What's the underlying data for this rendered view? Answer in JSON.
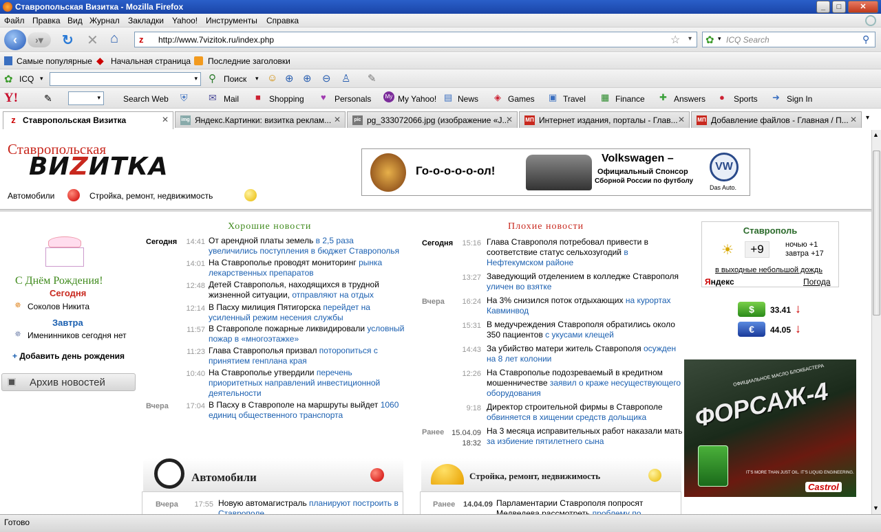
{
  "window": {
    "title": "Ставропольская Визитка - Mozilla Firefox",
    "btn_min": "_",
    "btn_max": "□",
    "btn_close": "✕"
  },
  "menu": [
    "Файл",
    "Правка",
    "Вид",
    "Журнал",
    "Закладки",
    "Yahoo!",
    "Инструменты",
    "Справка"
  ],
  "nav": {
    "url": "http://www.7vizitok.ru/index.php",
    "search_placeholder": "ICQ Search"
  },
  "bookmarks": [
    "Самые популярные",
    "Начальная страница",
    "Последние заголовки"
  ],
  "icqbar": {
    "icq": "ICQ",
    "search": "Поиск"
  },
  "yahoobar": {
    "logo": "Y!",
    "search_web": "Search Web",
    "items": [
      "Mail",
      "Shopping",
      "Personals",
      "My Yahoo!",
      "News",
      "Games",
      "Travel",
      "Finance",
      "Answers",
      "Sports",
      "Sign In"
    ]
  },
  "tabs": [
    {
      "label": "Ставропольская Визитка",
      "icon": "z"
    },
    {
      "label": "Яндекс.Картинки: визитка реклам...",
      "icon": "img"
    },
    {
      "label": "pg_333072066.jpg (изображение «J...",
      "icon": "pic"
    },
    {
      "label": "Интернет издания, порталы - Глав...",
      "icon": "МП"
    },
    {
      "label": "Добавление файлов - Главная / П...",
      "icon": "МП"
    }
  ],
  "site": {
    "logo_top": "Ставропольская",
    "logo_bottom": "ВИЗИТКА",
    "logo_z": "Z",
    "cat1": "Автомобили",
    "cat2": "Стройка, ремонт, недвижимость",
    "banner": {
      "goal": "Го-о-о-о-о-ол!",
      "vw_title": "Volkswagen –",
      "vw_sub1": "Официальный Спонсор",
      "vw_sub2": "Сборной России по футболу",
      "vw_das": "Das Auto."
    }
  },
  "birthday": {
    "title": "С Днём Рождения!",
    "today_label": "Сегодня",
    "today_name": "Соколов Никита",
    "tomorrow_label": "Завтра",
    "tomorrow_text": "Именинников сегодня нет",
    "add": "Добавить день рождения",
    "archive": "Архив новостей"
  },
  "good_news": {
    "title": "Хорошие новости",
    "items": [
      {
        "day": "Сегодня",
        "time": "14:41",
        "text": "От арендной платы земель ",
        "link": "в 2,5 раза увеличились поступления в бюджет Ставрополья"
      },
      {
        "day": "",
        "time": "14:01",
        "text": "На Ставрополье проводят мониторинг ",
        "link": "рынка лекарственных препаратов"
      },
      {
        "day": "",
        "time": "12:48",
        "text": "Детей Ставрополья, находящихся в трудной жизненной ситуации, ",
        "link": "отправляют на отдых"
      },
      {
        "day": "",
        "time": "12:14",
        "text": "В Пасху милиция Пятигорска ",
        "link": "перейдет на усиленный режим несения службы"
      },
      {
        "day": "",
        "time": "11:57",
        "text": "В Ставрополе пожарные ликвидировали ",
        "link": "условный пожар в «многоэтажке»"
      },
      {
        "day": "",
        "time": "11:23",
        "text": "Глава Ставрополья призвал ",
        "link": "поторопиться с принятием генплана края"
      },
      {
        "day": "",
        "time": "10:40",
        "text": "На Ставрополье утвердили ",
        "link": "перечень приоритетных направлений инвестиционной деятельности"
      },
      {
        "day": "Вчера",
        "time": "17:04",
        "text": "В Пасху в Ставрополе на маршруты выйдет ",
        "link": "1060 единиц общественного транспорта"
      }
    ]
  },
  "bad_news": {
    "title": "Плохие новости",
    "items": [
      {
        "day": "Сегодня",
        "time": "15:16",
        "text": "Глава Ставрополя потребовал привести в соответствие статус сельхозугодий ",
        "link": "в Нефтекумском районе"
      },
      {
        "day": "",
        "time": "13:27",
        "text": "Заведующий отделением в колледже Ставрополя ",
        "link": "уличен во взятке"
      },
      {
        "day": "Вчера",
        "time": "16:24",
        "text": "На 3% снизился поток отдыхающих ",
        "link": "на курортах Кавминвод"
      },
      {
        "day": "",
        "time": "15:31",
        "text": "В медучреждения Ставрополя обратились около 350 пациентов ",
        "link": "с укусами клещей"
      },
      {
        "day": "",
        "time": "14:43",
        "text": "За убийство матери житель Ставрополя ",
        "link": "осужден на 8 лет колонии"
      },
      {
        "day": "",
        "time": "12:26",
        "text": "На Ставрополье подозреваемый в кредитном мошенничестве ",
        "link": "заявил о краже несуществующего оборудования"
      },
      {
        "day": "",
        "time": "9:18",
        "text": "Директор строительной фирмы в Ставрополе ",
        "link": "обвиняется в хищении средств дольщика"
      },
      {
        "day": "Ранее",
        "time": "15.04.09 18:32",
        "text": "На 3 месяца исправительных работ наказали мать ",
        "link": "за избиение пятилетнего сына"
      }
    ]
  },
  "weather": {
    "city": "Ставрополь",
    "temp": "+9",
    "night": "ночью +1",
    "tomorrow": "завтра +17",
    "weekend": "в выходные небольшой дождь",
    "yandex": "Яндекс",
    "pogoda": "Погода"
  },
  "currency": [
    {
      "sym": "$",
      "value": "33.41",
      "arrow": "↓"
    },
    {
      "sym": "€",
      "value": "44.05",
      "arrow": "↓"
    }
  ],
  "forsazh": {
    "top": "ОФИЦИАЛЬНОЕ МАСЛО БЛОКБАСТЕРА",
    "title": "ФОРСАЖ-4",
    "slogan": "IT'S MORE THAN JUST OIL. IT'S LIQUID ENGINEERING.",
    "brand": "Castrol"
  },
  "auto_section": {
    "title": "Автомобили",
    "day": "Вчера",
    "time": "17:55",
    "text": "Новую автомагистраль ",
    "link": "планируют построить в Ставрополе"
  },
  "build_section": {
    "title": "Стройка, ремонт, недвижимость",
    "day": "Ранее",
    "time": "14.04.09",
    "text": "Парламентарии Ставрополя попросят Медведева рассмотреть ",
    "link": "проблему по"
  },
  "status": "Готово"
}
